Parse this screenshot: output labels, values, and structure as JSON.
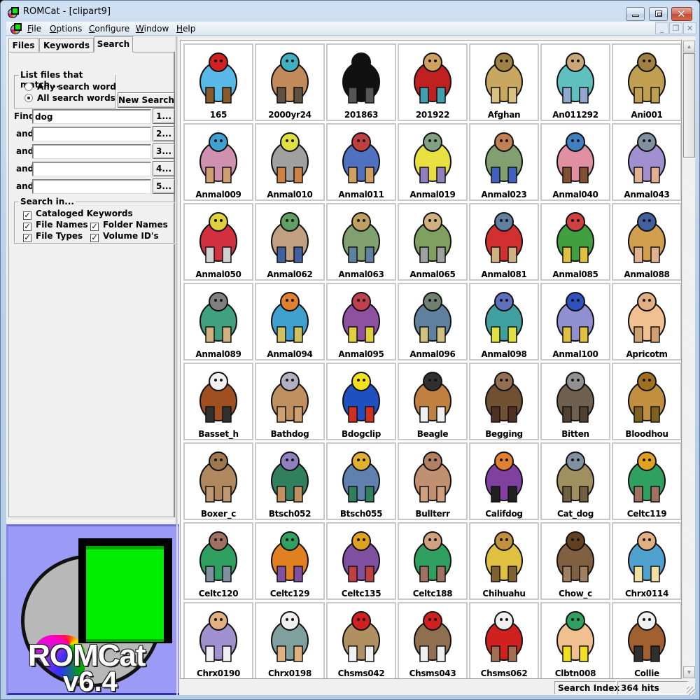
{
  "window": {
    "title": "ROMCat - [clipart9]",
    "controls": {
      "minimize": "minimize",
      "maximize": "maximize",
      "close": "close"
    }
  },
  "menubar": {
    "items": [
      {
        "label": "File",
        "accel": "F",
        "rest": "ile"
      },
      {
        "label": "Options",
        "accel": "O",
        "rest": "ptions"
      },
      {
        "label": "Configure",
        "accel": "C",
        "rest": "onfigure"
      },
      {
        "label": "Window",
        "accel": "W",
        "rest": "indow"
      },
      {
        "label": "Help",
        "accel": "H",
        "rest": "elp"
      }
    ],
    "mdi_controls": {
      "minimize": "_",
      "restore": "❐",
      "close": "✕"
    }
  },
  "left_panel": {
    "tabs": [
      {
        "label": "Files",
        "active": false
      },
      {
        "label": "Keywords",
        "active": false
      },
      {
        "label": "Search",
        "active": true
      }
    ],
    "match_group": {
      "title": "List files that match...",
      "options": [
        {
          "label": "Any search word",
          "selected": false
        },
        {
          "label": "All search words",
          "selected": true
        }
      ]
    },
    "new_search_button": "New Search",
    "find_rows": [
      {
        "label": "Find",
        "value": "dog",
        "button": "1..."
      },
      {
        "label": "and",
        "value": "",
        "button": "2..."
      },
      {
        "label": "and",
        "value": "",
        "button": "3..."
      },
      {
        "label": "and",
        "value": "",
        "button": "4..."
      },
      {
        "label": "and",
        "value": "",
        "button": "5..."
      }
    ],
    "search_in_group": {
      "title": "Search in...",
      "options": [
        {
          "label": "Cataloged Keywords",
          "checked": true
        },
        {
          "label": "File Names",
          "checked": true
        },
        {
          "label": "Folder Names",
          "checked": true
        },
        {
          "label": "File Types",
          "checked": true
        },
        {
          "label": "Volume ID's",
          "checked": true
        }
      ]
    },
    "logo": {
      "title": "ROMCat",
      "version": "v6.4"
    }
  },
  "thumbnails": [
    {
      "name": "165",
      "colors": [
        "#58b8e8",
        "#d02020",
        "#8a5a2a"
      ]
    },
    {
      "name": "2000yr24",
      "colors": [
        "#c08a5a",
        "#40b0c0",
        "#605040"
      ]
    },
    {
      "name": "201863",
      "colors": [
        "#111111",
        "#111111",
        "#555555"
      ]
    },
    {
      "name": "201922",
      "colors": [
        "#c02020",
        "#d0a060",
        "#40a0b0"
      ]
    },
    {
      "name": "Afghan",
      "colors": [
        "#c8a860",
        "#a08040",
        "#d8c080"
      ]
    },
    {
      "name": "An011292",
      "colors": [
        "#60c0c0",
        "#c8a878",
        "#90a8d0"
      ]
    },
    {
      "name": "Ani001",
      "colors": [
        "#c0a050",
        "#a08040",
        "#c0a050"
      ]
    },
    {
      "name": "Anmal009",
      "colors": [
        "#d090b0",
        "#40a0d0",
        "#d0a070"
      ]
    },
    {
      "name": "Anmal010",
      "colors": [
        "#a0a0a0",
        "#e0e040",
        "#d08040"
      ]
    },
    {
      "name": "Anmal011",
      "colors": [
        "#5070c0",
        "#c04040",
        "#d0a060"
      ]
    },
    {
      "name": "Anmal019",
      "colors": [
        "#e8e040",
        "#80a080",
        "#9080c0"
      ]
    },
    {
      "name": "Anmal023",
      "colors": [
        "#80a070",
        "#c08050",
        "#4060c0"
      ]
    },
    {
      "name": "Anmal040",
      "colors": [
        "#e090a0",
        "#4080c0",
        "#805030"
      ]
    },
    {
      "name": "Anmal043",
      "colors": [
        "#a090d0",
        "#8090a0",
        "#e0b090"
      ]
    },
    {
      "name": "Anmal050",
      "colors": [
        "#d03040",
        "#e0d040",
        "#d0d0d0"
      ]
    },
    {
      "name": "Anmal062",
      "colors": [
        "#c0a080",
        "#60a060",
        "#4060a0"
      ]
    },
    {
      "name": "Anmal063",
      "colors": [
        "#80a070",
        "#c0a060",
        "#6080a0"
      ]
    },
    {
      "name": "Anmal065",
      "colors": [
        "#80a060",
        "#d0b080",
        "#a0a0a0"
      ]
    },
    {
      "name": "Anmal081",
      "colors": [
        "#d03030",
        "#6080a0",
        "#d0b080"
      ]
    },
    {
      "name": "Anmal085",
      "colors": [
        "#40a040",
        "#d04040",
        "#e0c040"
      ]
    },
    {
      "name": "Anmal088",
      "colors": [
        "#d0a050",
        "#4060a0",
        "#e0b090"
      ]
    },
    {
      "name": "Anmal089",
      "colors": [
        "#40a080",
        "#808080",
        "#d0b080"
      ]
    },
    {
      "name": "Anmal094",
      "colors": [
        "#40a0d0",
        "#e08030",
        "#d0c060"
      ]
    },
    {
      "name": "Anmal095",
      "colors": [
        "#9050a0",
        "#c04050",
        "#e0d040"
      ]
    },
    {
      "name": "Anmal096",
      "colors": [
        "#6080a0",
        "#708070",
        "#d0c080"
      ]
    },
    {
      "name": "Anmal098",
      "colors": [
        "#40a0a0",
        "#6070c0",
        "#e0e040"
      ]
    },
    {
      "name": "Anmal100",
      "colors": [
        "#9090d0",
        "#3050c0",
        "#e0c040"
      ]
    },
    {
      "name": "Apricotm",
      "colors": [
        "#f0c090",
        "#e0b080",
        "#d0a070"
      ]
    },
    {
      "name": "Basset_h",
      "colors": [
        "#a05020",
        "#f0f0f0",
        "#303030"
      ]
    },
    {
      "name": "Bathdog",
      "colors": [
        "#c09060",
        "#b0b0c0",
        "#d0a070"
      ]
    },
    {
      "name": "Bdogclip",
      "colors": [
        "#2050c0",
        "#f0e020",
        "#d03020"
      ]
    },
    {
      "name": "Beagle",
      "colors": [
        "#c08040",
        "#303030",
        "#f0f0f0"
      ]
    },
    {
      "name": "Begging",
      "colors": [
        "#705030",
        "#907050",
        "#503020"
      ]
    },
    {
      "name": "Bitten",
      "colors": [
        "#706050",
        "#909090",
        "#504030"
      ]
    },
    {
      "name": "Bloodhou",
      "colors": [
        "#c09040",
        "#a07020",
        "#806020"
      ]
    },
    {
      "name": "Boxer_c",
      "colors": [
        "#b08860",
        "#a07850",
        "#c09870"
      ]
    },
    {
      "name": "Btsch052",
      "colors": [
        "#308060",
        "#9080c0",
        "#c09060"
      ]
    },
    {
      "name": "Btsch055",
      "colors": [
        "#6080b0",
        "#e0b030",
        "#308060"
      ]
    },
    {
      "name": "Bullterr",
      "colors": [
        "#c09070",
        "#b08060",
        "#d0a080"
      ]
    },
    {
      "name": "Califdog",
      "colors": [
        "#8040a0",
        "#e08030",
        "#202020"
      ]
    },
    {
      "name": "Cat_dog",
      "colors": [
        "#a09060",
        "#8090a0",
        "#706040"
      ]
    },
    {
      "name": "Celtc119",
      "colors": [
        "#30a060",
        "#e0a020",
        "#a07060"
      ]
    },
    {
      "name": "Celtc120",
      "colors": [
        "#30a060",
        "#a07060",
        "#8090a0"
      ]
    },
    {
      "name": "Celtc129",
      "colors": [
        "#e08020",
        "#30a060",
        "#8050a0"
      ]
    },
    {
      "name": "Celtc135",
      "colors": [
        "#8050a0",
        "#e0a020",
        "#c04040"
      ]
    },
    {
      "name": "Celtc188",
      "colors": [
        "#30a060",
        "#d0a080",
        "#a07060"
      ]
    },
    {
      "name": "Chihuahu",
      "colors": [
        "#e0c040",
        "#c09040",
        "#806030"
      ]
    },
    {
      "name": "Chow_c",
      "colors": [
        "#806040",
        "#604020",
        "#a08060"
      ]
    },
    {
      "name": "Chrx0114",
      "colors": [
        "#50a0d0",
        "#e0b080",
        "#f0e0a0"
      ]
    },
    {
      "name": "Chrx0190",
      "colors": [
        "#a090d0",
        "#e0b080",
        "#f0f0f0"
      ]
    },
    {
      "name": "Chrx0198",
      "colors": [
        "#80a0a0",
        "#f0f0f0",
        "#e0b080"
      ]
    },
    {
      "name": "Chsms042",
      "colors": [
        "#b09060",
        "#d02020",
        "#f0f0f0"
      ]
    },
    {
      "name": "Chsms043",
      "colors": [
        "#907050",
        "#d02020",
        "#f0f0f0"
      ]
    },
    {
      "name": "Chsms062",
      "colors": [
        "#d02020",
        "#f0f0f0",
        "#a07050"
      ]
    },
    {
      "name": "Clbtn008",
      "colors": [
        "#f0c090",
        "#30a060",
        "#f0e020"
      ]
    },
    {
      "name": "Collie",
      "colors": [
        "#a06030",
        "#f0f0f0",
        "#303030"
      ]
    }
  ],
  "scrollbar": {
    "position_fraction": 0.0,
    "visible_fraction": 0.17
  },
  "statusbar": {
    "left": "",
    "mode": "Search Index",
    "hits": "364 hits"
  }
}
